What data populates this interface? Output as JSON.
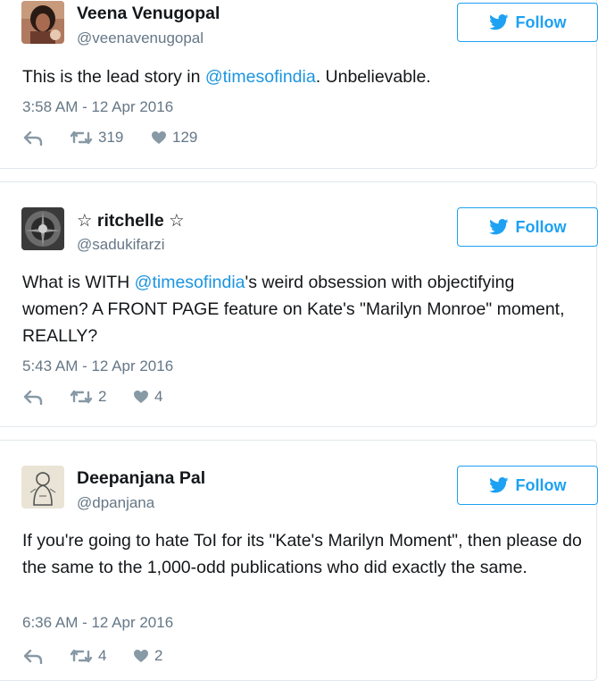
{
  "tweets": [
    {
      "name": "Veena Venugopal",
      "handle": "@veenavenugopal",
      "follow_label": "Follow",
      "text_before": "This is the lead story in ",
      "mention": "@timesofindia",
      "text_after": ". Unbelievable.",
      "timestamp": "3:58 AM - 12 Apr 2016",
      "retweets": "319",
      "likes": "129"
    },
    {
      "name": "☆ ritchelle ☆",
      "handle": "@sadukifarzi",
      "follow_label": "Follow",
      "text_before": "What is WITH ",
      "mention": "@timesofindia",
      "text_after": "'s weird obsession with objectifying women? A FRONT PAGE feature on Kate's \"Marilyn Monroe\" moment, REALLY?",
      "timestamp": "5:43 AM - 12 Apr 2016",
      "retweets": "2",
      "likes": "4"
    },
    {
      "name": "Deepanjana Pal",
      "handle": "@dpanjana",
      "follow_label": "Follow",
      "text": "If you're going to hate ToI for its \"Kate's Marilyn Moment\", then please do the same to the 1,000-odd publications who did exactly the same.",
      "timestamp": "6:36 AM - 12 Apr 2016",
      "retweets": "4",
      "likes": "2"
    }
  ],
  "colors": {
    "accent": "#1da1f2",
    "mention": "#1b95e0",
    "muted": "#657786",
    "border": "#e1e8ed"
  }
}
